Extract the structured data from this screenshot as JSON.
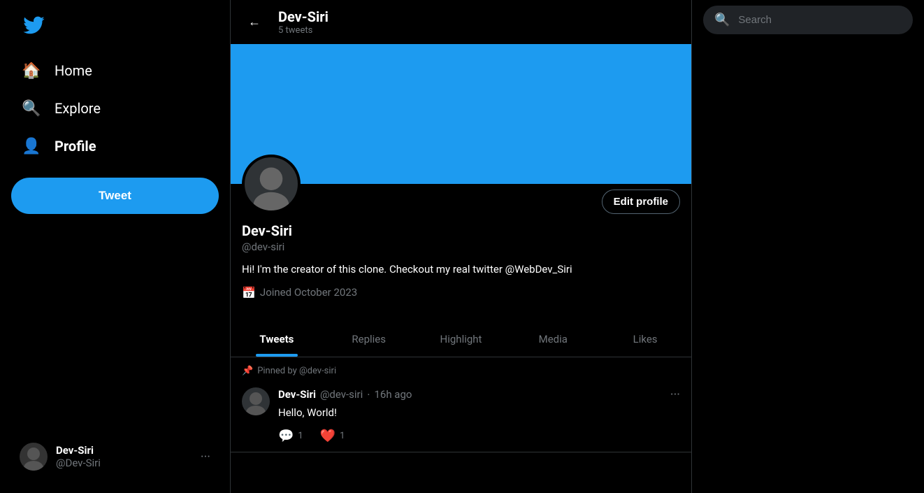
{
  "sidebar": {
    "logo_alt": "Twitter Bird",
    "nav_items": [
      {
        "id": "home",
        "label": "Home",
        "icon": "🏠",
        "active": false
      },
      {
        "id": "explore",
        "label": "Explore",
        "icon": "🔍",
        "active": false
      },
      {
        "id": "profile",
        "label": "Profile",
        "icon": "👤",
        "active": true
      }
    ],
    "tweet_button_label": "Tweet",
    "user": {
      "name": "Dev-Siri",
      "handle": "@Dev-Siri"
    }
  },
  "profile": {
    "back_label": "←",
    "header_name": "Dev-Siri",
    "header_tweets_count": "5 tweets",
    "banner_color": "#1d9bf0",
    "display_name": "Dev-Siri",
    "handle": "@dev-siri",
    "bio": "Hi! I'm the creator of this clone. Checkout my real twitter @WebDev_Siri",
    "joined": "Joined October 2023",
    "edit_profile_label": "Edit profile",
    "tabs": [
      {
        "id": "tweets",
        "label": "Tweets",
        "active": true
      },
      {
        "id": "replies",
        "label": "Replies",
        "active": false
      },
      {
        "id": "highlight",
        "label": "Highlight",
        "active": false
      },
      {
        "id": "media",
        "label": "Media",
        "active": false
      },
      {
        "id": "likes",
        "label": "Likes",
        "active": false
      }
    ]
  },
  "tweets": {
    "pinned_label": "Pinned by @dev-siri",
    "items": [
      {
        "author_name": "Dev-Siri",
        "author_handle": "@dev-siri",
        "time_ago": "16h ago",
        "text": "Hello, World!",
        "replies": 1,
        "likes": 1
      }
    ]
  },
  "search": {
    "placeholder": "Search"
  }
}
